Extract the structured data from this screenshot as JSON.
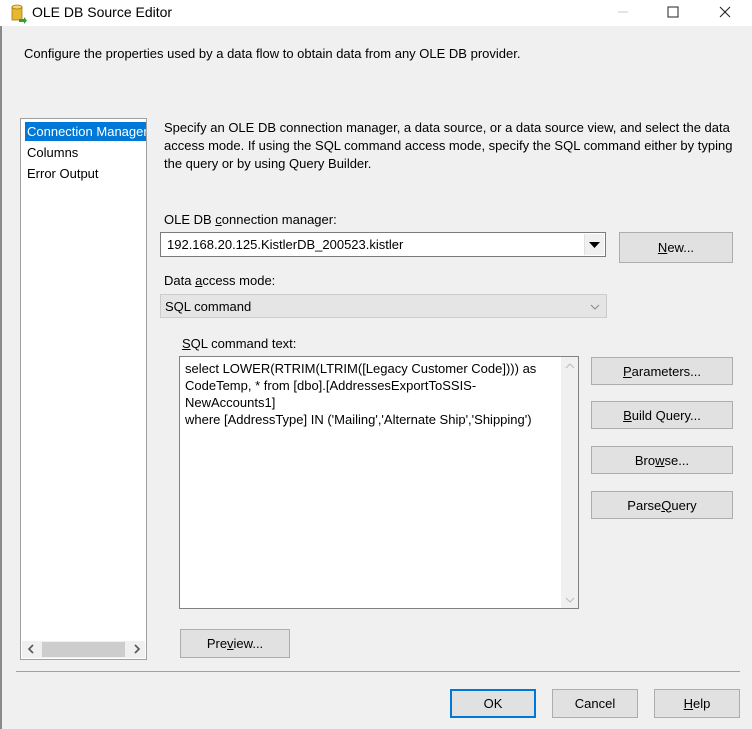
{
  "window": {
    "title": "OLE DB Source Editor",
    "icon": "database-source-icon",
    "controls": {
      "minimize": "minimize-icon",
      "maximize": "maximize-icon",
      "close": "close-icon"
    }
  },
  "description": "Configure the properties used by a data flow to obtain data from any OLE DB provider.",
  "nav": {
    "items": [
      {
        "label": "Connection Manager",
        "selected": true
      },
      {
        "label": "Columns",
        "selected": false
      },
      {
        "label": "Error Output",
        "selected": false
      }
    ]
  },
  "instructions": "Specify an OLE DB connection manager, a data source, or a data source view, and select the data access mode. If using the SQL command access mode, specify the SQL command either by typing the query or by using Query Builder.",
  "connection": {
    "label_pre": "OLE DB ",
    "label_key": "c",
    "label_post": "onnection manager:",
    "value": "192.168.20.125.KistlerDB_200523.kistler",
    "new_button": {
      "key": "N",
      "rest": "ew..."
    }
  },
  "access_mode": {
    "label_pre": "Data ",
    "label_key": "a",
    "label_post": "ccess mode:",
    "value": "SQL command"
  },
  "sql": {
    "label_key": "S",
    "label_post": "QL command text:",
    "text": "select LOWER(RTRIM(LTRIM([Legacy Customer Code]))) as\nCodeTemp, * from [dbo].[AddressesExportToSSIS-\nNewAccounts1]\nwhere [AddressType] IN ('Mailing','Alternate Ship','Shipping')"
  },
  "side_buttons": {
    "parameters": {
      "pre": "",
      "key": "P",
      "post": "arameters..."
    },
    "build_query": {
      "pre": "",
      "key": "B",
      "post": "uild Query..."
    },
    "browse": {
      "pre": "Bro",
      "key": "w",
      "post": "se..."
    },
    "parse_query": {
      "pre": "Parse ",
      "key": "Q",
      "post": "uery"
    }
  },
  "preview_button": {
    "pre": "Pre",
    "key": "v",
    "post": "iew..."
  },
  "footer": {
    "ok": "OK",
    "cancel": "Cancel",
    "help": {
      "key": "H",
      "post": "elp"
    }
  }
}
